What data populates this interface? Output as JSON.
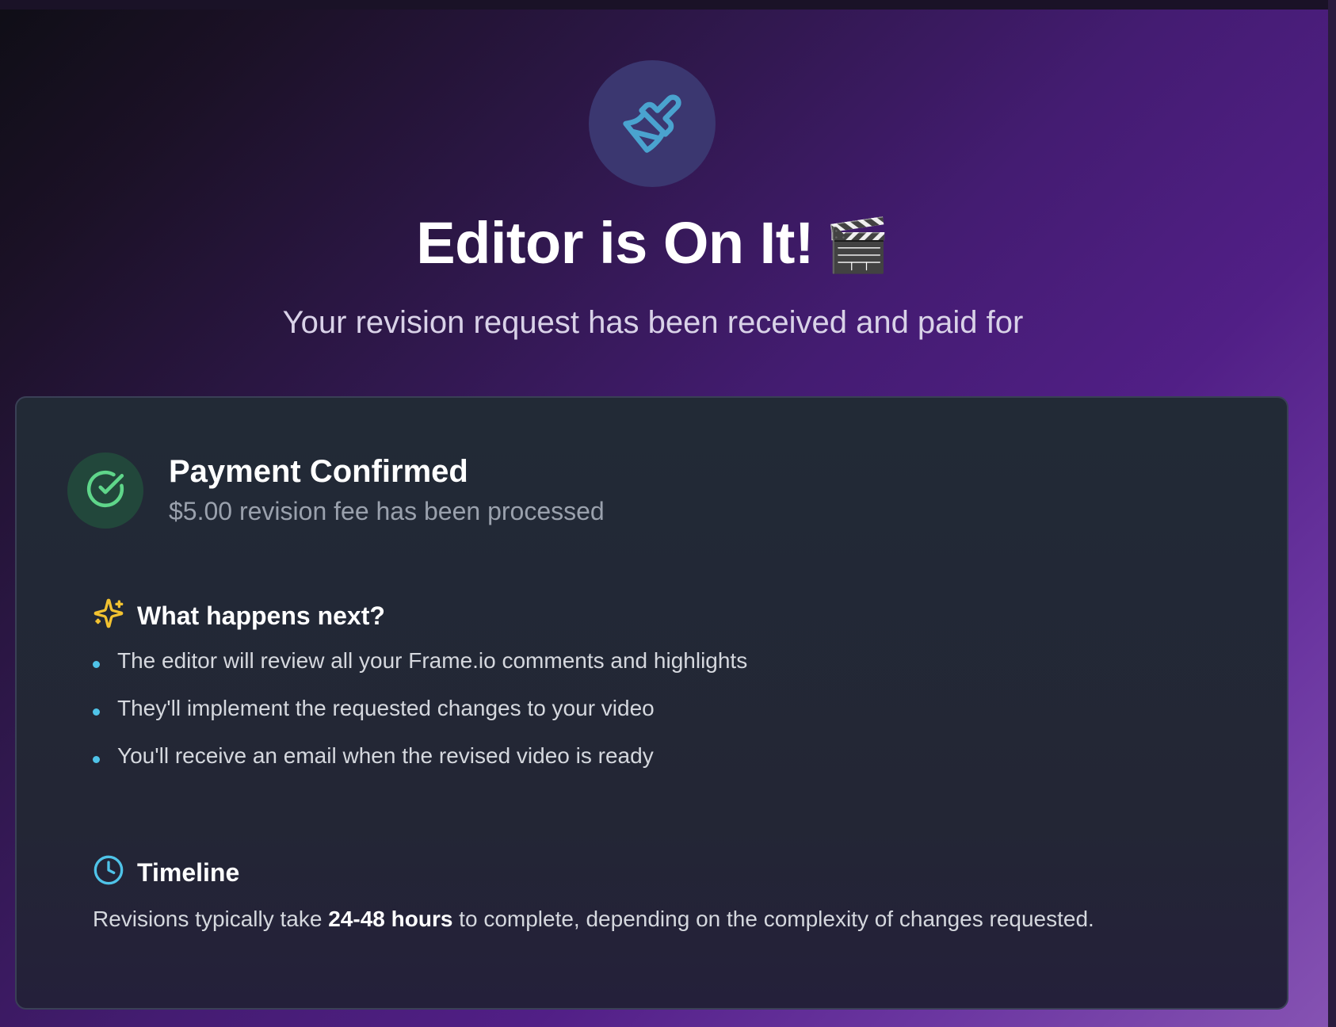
{
  "hero": {
    "icon": "paintbrush-icon",
    "title": "Editor is On It!",
    "title_emoji": "🎬",
    "subtitle": "Your revision request has been received and paid for"
  },
  "payment": {
    "icon": "check-circle-icon",
    "title": "Payment Confirmed",
    "subtitle": "$5.00 revision fee has been processed"
  },
  "next_steps": {
    "icon": "sparkles-icon",
    "heading": "What happens next?",
    "items": [
      "The editor will review all your Frame.io comments and highlights",
      "They'll implement the requested changes to your video",
      "You'll receive an email when the revised video is ready"
    ]
  },
  "timeline": {
    "icon": "clock-icon",
    "heading": "Timeline",
    "text_before": "Revisions typically take ",
    "text_bold": "24-48 hours",
    "text_after": " to complete, depending on the complexity of changes requested."
  },
  "colors": {
    "accent_cyan": "#4fc3e8",
    "success_green": "#5fd68a",
    "sparkle_yellow": "#f2c230",
    "hero_circle": "#3b3770"
  }
}
